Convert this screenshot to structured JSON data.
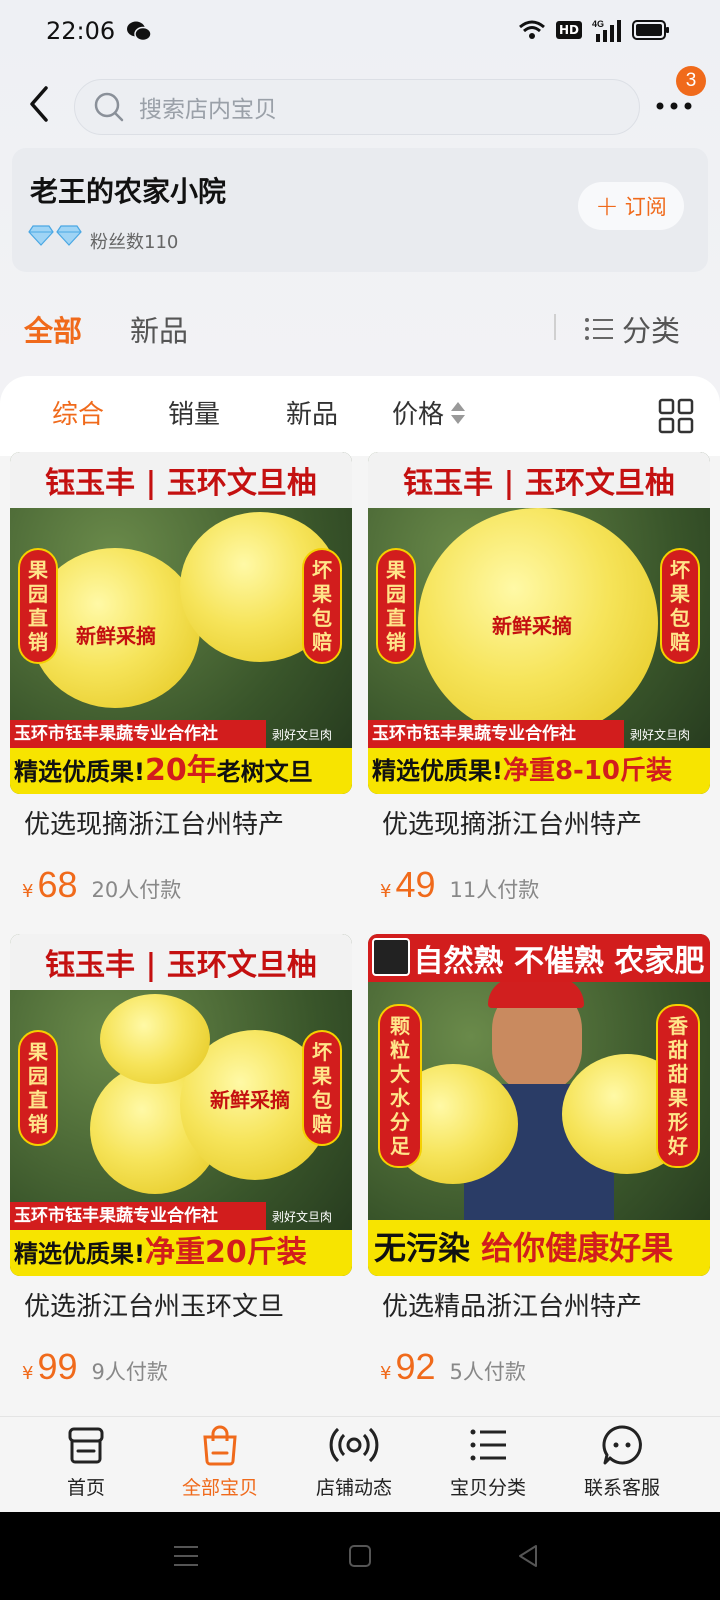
{
  "status_bar": {
    "time": "22:06",
    "network": "4G",
    "hd": "HD"
  },
  "header": {
    "search_placeholder": "搜索店内宝贝",
    "badge_count": "3"
  },
  "shop": {
    "name": "老王的农家小院",
    "fans": "粉丝数110",
    "subscribe_label": "订阅"
  },
  "shop_tabs": {
    "all": "全部",
    "new": "新品",
    "category": "分类"
  },
  "sort_bar": {
    "comprehensive": "综合",
    "sales": "销量",
    "new": "新品",
    "price": "价格"
  },
  "products": [
    {
      "title": "优选现摘浙江台州特产",
      "price": "68",
      "sales": "20人付款",
      "banner_top": "钰玉丰 | 玉环文旦柚",
      "badge_left": "果园直销",
      "badge_right": "坏果包赔",
      "fresh": "新鲜采摘",
      "coop": "玉环市钰丰果蔬专业合作社",
      "peel": "剥好文旦肉",
      "bottom_dark": "精选优质果!",
      "bottom_red": "20年",
      "bottom_dark2": "老树文旦"
    },
    {
      "title": "优选现摘浙江台州特产",
      "price": "49",
      "sales": "11人付款",
      "banner_top": "钰玉丰 | 玉环文旦柚",
      "badge_left": "果园直销",
      "badge_right": "坏果包赔",
      "fresh": "新鲜采摘",
      "coop": "玉环市钰丰果蔬专业合作社",
      "peel": "剥好文旦肉",
      "bottom_dark": "精选优质果!",
      "bottom_red": "净重8-10斤装"
    },
    {
      "title": "优选浙江台州玉环文旦",
      "price": "99",
      "sales": "9人付款",
      "banner_top": "钰玉丰 | 玉环文旦柚",
      "badge_left": "果园直销",
      "badge_right": "坏果包赔",
      "fresh": "新鲜采摘",
      "coop": "玉环市钰丰果蔬专业合作社",
      "peel": "剥好文旦肉",
      "bottom_dark": "精选优质果!",
      "bottom_red": "净重20斤装"
    },
    {
      "title": "优选精品浙江台州特产",
      "price": "92",
      "sales": "5人付款",
      "banner_top": "自然熟 不催熟 农家肥",
      "badge_left": "颗粒大 水分足",
      "badge_right": "香甜甜 果形好",
      "bottom_dark": "无污染",
      "bottom_red": "给你健康好果"
    }
  ],
  "currency": "¥",
  "tab_bar": {
    "home": "首页",
    "all_items": "全部宝贝",
    "dynamics": "店铺动态",
    "categories": "宝贝分类",
    "service": "联系客服"
  },
  "colors": {
    "accent": "#f06a1b",
    "banner_red": "#d21d1d",
    "banner_yellow": "#f7e400"
  }
}
